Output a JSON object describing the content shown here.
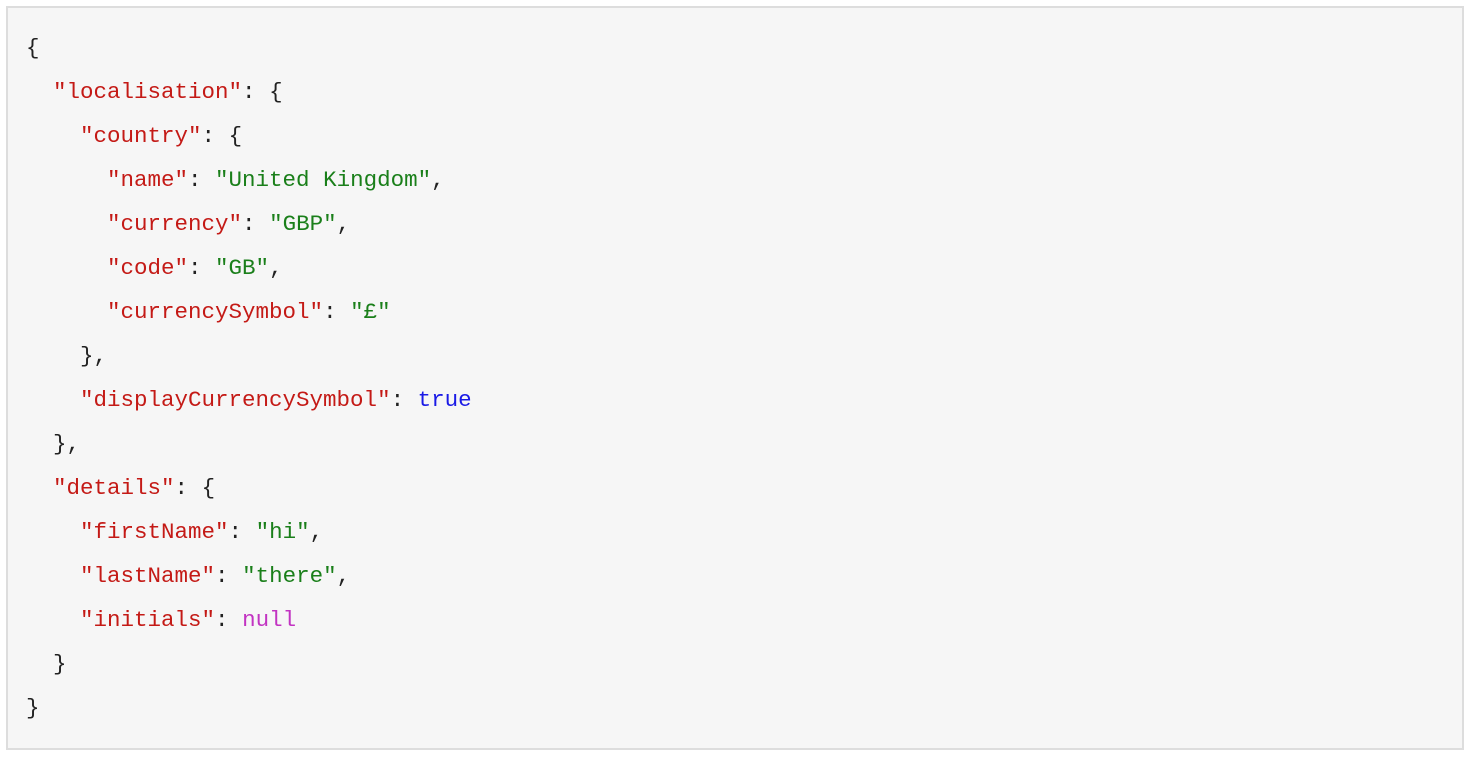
{
  "syntaxColors": {
    "key": "#c41a16",
    "string": "#1a7f1a",
    "boolean": "#1a1ae6",
    "null": "#c233c2",
    "punct": "#222222"
  },
  "code": {
    "localisation_key": "\"localisation\"",
    "country_key": "\"country\"",
    "name_key": "\"name\"",
    "name_val": "\"United Kingdom\"",
    "currency_key": "\"currency\"",
    "currency_val": "\"GBP\"",
    "code_key": "\"code\"",
    "code_val": "\"GB\"",
    "currencySymbol_key": "\"currencySymbol\"",
    "currencySymbol_val": "\"£\"",
    "displayCurrencySymbol_key": "\"displayCurrencySymbol\"",
    "displayCurrencySymbol_val": "true",
    "details_key": "\"details\"",
    "firstName_key": "\"firstName\"",
    "firstName_val": "\"hi\"",
    "lastName_key": "\"lastName\"",
    "lastName_val": "\"there\"",
    "initials_key": "\"initials\"",
    "initials_val": "null",
    "brace_open": "{",
    "brace_close": "}",
    "brace_close_comma": "},",
    "colon_sp": ": ",
    "comma": ","
  }
}
